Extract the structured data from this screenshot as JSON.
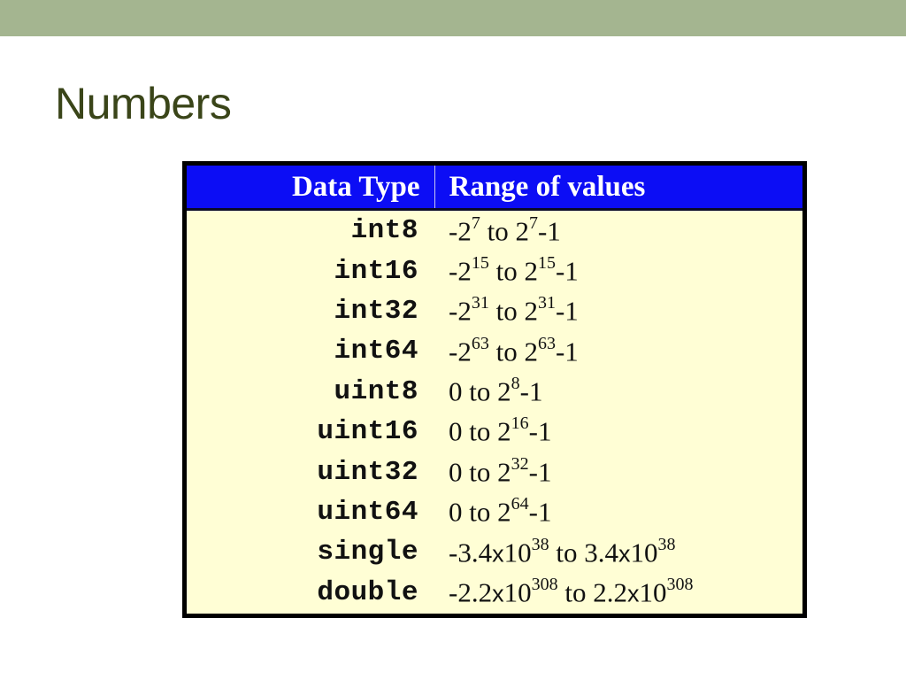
{
  "slide": {
    "title": "Numbers"
  },
  "colors": {
    "top_band": "#a4b590",
    "title_text": "#3a4519",
    "table_header_bg": "#0c0df5",
    "table_body_bg": "#fffed5",
    "table_border": "#000000"
  },
  "table": {
    "headers": {
      "type": "Data Type",
      "range": "Range of values"
    },
    "rows": [
      {
        "type": "int8",
        "range": [
          {
            "t": "-2"
          },
          {
            "s": "7"
          },
          {
            "t": " to 2"
          },
          {
            "s": "7"
          },
          {
            "t": "-1"
          }
        ]
      },
      {
        "type": "int16",
        "range": [
          {
            "t": "-2"
          },
          {
            "s": "15"
          },
          {
            "t": " to 2"
          },
          {
            "s": "15"
          },
          {
            "t": "-1"
          }
        ]
      },
      {
        "type": "int32",
        "range": [
          {
            "t": "-2"
          },
          {
            "s": "31"
          },
          {
            "t": " to 2"
          },
          {
            "s": "31"
          },
          {
            "t": "-1"
          }
        ]
      },
      {
        "type": "int64",
        "range": [
          {
            "t": "-2"
          },
          {
            "s": "63"
          },
          {
            "t": " to 2"
          },
          {
            "s": "63"
          },
          {
            "t": "-1"
          }
        ]
      },
      {
        "type": "uint8",
        "range": [
          {
            "t": "0 to 2"
          },
          {
            "s": "8"
          },
          {
            "t": "-1"
          }
        ]
      },
      {
        "type": "uint16",
        "range": [
          {
            "t": "0 to 2"
          },
          {
            "s": "16"
          },
          {
            "t": "-1"
          }
        ]
      },
      {
        "type": "uint32",
        "range": [
          {
            "t": "0 to 2"
          },
          {
            "s": "32"
          },
          {
            "t": "-1"
          }
        ]
      },
      {
        "type": "uint64",
        "range": [
          {
            "t": "0 to 2"
          },
          {
            "s": "64"
          },
          {
            "t": "-1"
          }
        ]
      },
      {
        "type": "single",
        "range": [
          {
            "t": "-3.4"
          },
          {
            "x": "x"
          },
          {
            "t": "10"
          },
          {
            "s": "38"
          },
          {
            "t": " to 3.4"
          },
          {
            "x": "x"
          },
          {
            "t": "10"
          },
          {
            "s": "38"
          }
        ]
      },
      {
        "type": "double",
        "range": [
          {
            "t": "-2.2"
          },
          {
            "x": "x"
          },
          {
            "t": "10"
          },
          {
            "s": "308"
          },
          {
            "t": " to 2.2"
          },
          {
            "x": "x"
          },
          {
            "t": "10"
          },
          {
            "s": "308"
          }
        ]
      }
    ]
  }
}
